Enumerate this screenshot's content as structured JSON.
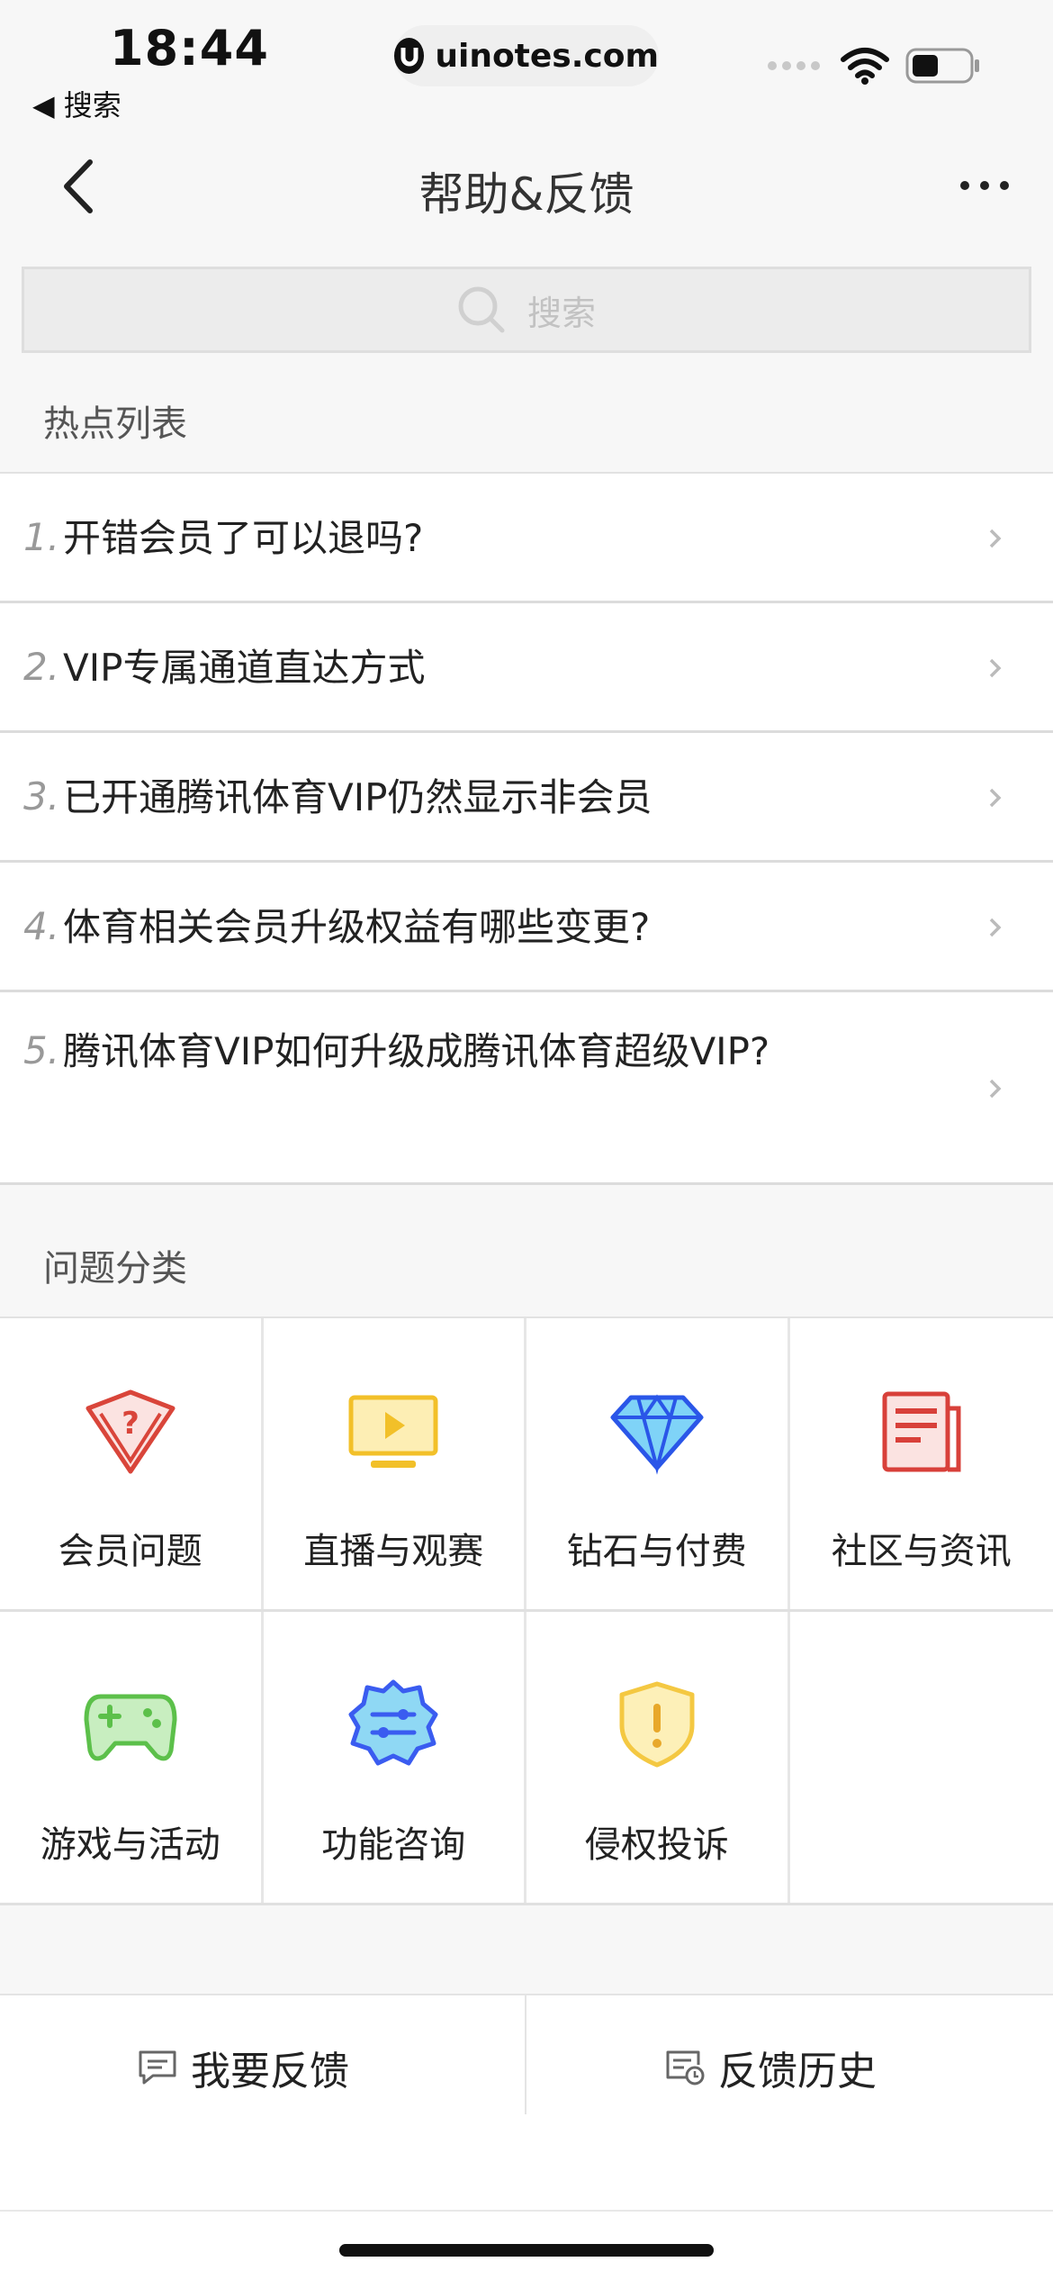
{
  "status_bar": {
    "time": "18:44",
    "back_app": "◀ 搜索",
    "url": "uinotes.com"
  },
  "nav": {
    "title": "帮助&反馈"
  },
  "search": {
    "placeholder": "搜索"
  },
  "hot_section": {
    "title": "热点列表",
    "items": [
      {
        "num": "1.",
        "text": "开错会员了可以退吗?"
      },
      {
        "num": "2.",
        "text": "VIP专属通道直达方式"
      },
      {
        "num": "3.",
        "text": "已开通腾讯体育VIP仍然显示非会员"
      },
      {
        "num": "4.",
        "text": "体育相关会员升级权益有哪些变更?"
      },
      {
        "num": "5.",
        "text": "腾讯体育VIP如何升级成腾讯体育超级VIP?"
      }
    ]
  },
  "category_section": {
    "title": "问题分类",
    "items": [
      {
        "label": "会员问题",
        "icon": "member-badge-icon"
      },
      {
        "label": "直播与观赛",
        "icon": "tv-play-icon"
      },
      {
        "label": "钻石与付费",
        "icon": "diamond-icon"
      },
      {
        "label": "社区与资讯",
        "icon": "news-icon"
      },
      {
        "label": "游戏与活动",
        "icon": "gamepad-icon"
      },
      {
        "label": "功能咨询",
        "icon": "gear-sliders-icon"
      },
      {
        "label": "侵权投诉",
        "icon": "shield-alert-icon"
      }
    ]
  },
  "bottom_bar": {
    "feedback_label": "我要反馈",
    "history_label": "反馈历史"
  },
  "colors": {
    "background": "#f7f7f7",
    "member_red": "#d9453a",
    "live_yellow": "#f2c029",
    "diamond_blue": "#2a56e8",
    "news_red": "#d8403a",
    "game_green": "#5cc04a",
    "function_blue": "#3a5cf0",
    "shield_yellow": "#f4c842"
  }
}
